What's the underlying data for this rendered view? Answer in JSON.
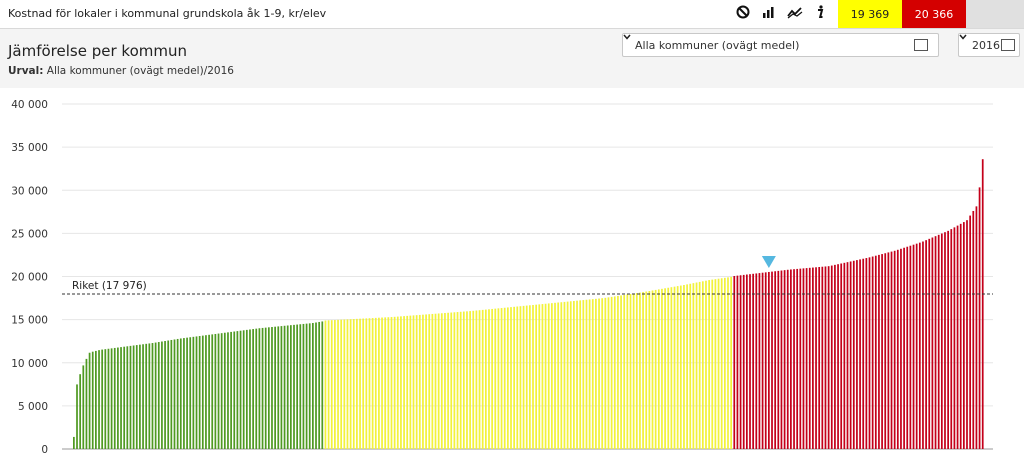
{
  "header": {
    "title": "Kostnad för lokaler i kommunal grundskola åk 1-9, kr/elev",
    "icons": [
      "block-icon",
      "bar-chart-icon",
      "line-chart-icon",
      "info-icon"
    ],
    "badge_yellow": "19 369",
    "badge_red": "20 366"
  },
  "panel": {
    "heading": "Jämförelse per kommun",
    "urval_label": "Urval:",
    "urval_value": "Alla kommuner (ovägt medel)/2016",
    "kommun_select": "Alla kommuner (ovägt medel)",
    "year_select": "2016"
  },
  "colors": {
    "green": "#4f9a22",
    "yellow": "#f2f23a",
    "red": "#c4001a",
    "marker": "#55b8e0"
  },
  "chart_data": {
    "type": "bar",
    "sorted": "ascending",
    "bar_count": 290,
    "ylim": [
      0,
      40000
    ],
    "yticks": [
      "0",
      "5 000",
      "10 000",
      "15 000",
      "20 000",
      "25 000",
      "30 000",
      "35 000",
      "40 000"
    ],
    "grid": true,
    "reference_line": {
      "label": "Riket (17 976)",
      "value": 17976
    },
    "thresholds": {
      "green_max": 14800,
      "yellow_max": 20000
    },
    "highlight_value": 20500,
    "anchors": [
      [
        0,
        1400
      ],
      [
        1,
        7300
      ],
      [
        2,
        8300
      ],
      [
        3,
        9300
      ],
      [
        4,
        10000
      ],
      [
        5,
        10600
      ],
      [
        6,
        11200
      ],
      [
        10,
        11500
      ],
      [
        20,
        11900
      ],
      [
        30,
        12300
      ],
      [
        40,
        12800
      ],
      [
        50,
        13200
      ],
      [
        60,
        13600
      ],
      [
        70,
        14000
      ],
      [
        80,
        14300
      ],
      [
        90,
        14600
      ],
      [
        94,
        14800
      ],
      [
        95,
        14900
      ],
      [
        120,
        15300
      ],
      [
        150,
        16000
      ],
      [
        180,
        16900
      ],
      [
        200,
        17500
      ],
      [
        215,
        18200
      ],
      [
        230,
        19000
      ],
      [
        240,
        19600
      ],
      [
        248,
        19950
      ],
      [
        249,
        20050
      ],
      [
        270,
        20800
      ],
      [
        285,
        21200
      ],
      [
        300,
        22200
      ],
      [
        310,
        23000
      ],
      [
        320,
        24000
      ],
      [
        330,
        25300
      ],
      [
        337,
        26500
      ],
      [
        341,
        28300
      ],
      [
        342,
        30800
      ],
      [
        343,
        33600
      ]
    ],
    "anchor_max_index": 343
  }
}
